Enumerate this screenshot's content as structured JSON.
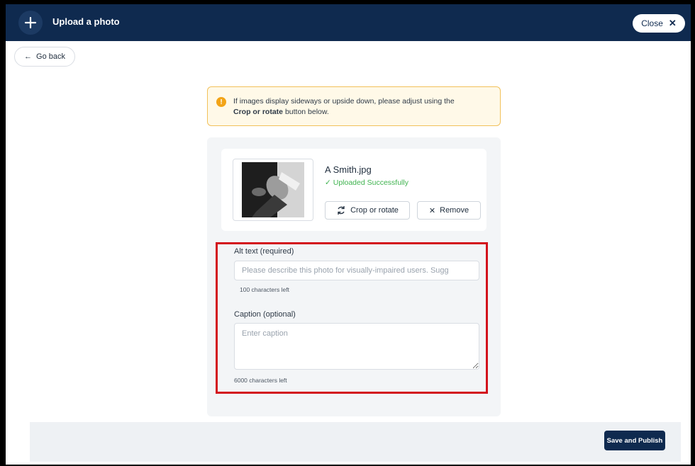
{
  "header": {
    "title": "Upload a photo",
    "close_label": "Close",
    "plus_icon": "plus-icon",
    "close_icon": "close-icon",
    "bg_color": "#0f2a4f"
  },
  "nav": {
    "go_back_label": "Go back",
    "back_icon": "arrow-left-icon"
  },
  "notice": {
    "text_before": "If images display sideways or upside down, please adjust using the",
    "bold_text": "Crop or rotate",
    "text_after": "button below.",
    "icon": "warning-icon",
    "accent_color": "#f3a417"
  },
  "file": {
    "name": "A Smith.jpg",
    "status": "Uploaded Successfully",
    "status_icon": "check-icon",
    "status_color": "#3fb34f",
    "crop_label": "Crop or rotate",
    "crop_icon": "rotate-icon",
    "remove_label": "Remove",
    "remove_icon": "x-icon"
  },
  "form": {
    "alt_label": "Alt text (required)",
    "alt_placeholder": "Please describe this photo for visually-impaired users. Sugg",
    "alt_counter": "100 characters left",
    "caption_label": "Caption (optional)",
    "caption_placeholder": "Enter caption",
    "caption_counter": "6000 characters left",
    "highlight_color": "#d3121c"
  },
  "footer": {
    "save_label": "Save and Publish"
  }
}
